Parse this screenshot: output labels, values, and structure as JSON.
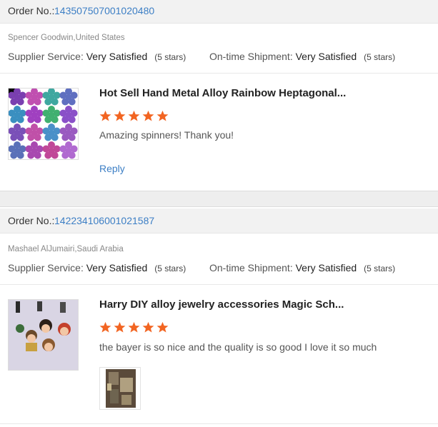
{
  "orders": [
    {
      "order_label": "Order No.:",
      "order_number": "143507507001020480",
      "buyer": "Spencer Goodwin,United States",
      "supplier_label": "Supplier Service:",
      "supplier_value": "Very Satisfied",
      "supplier_stars": "(5 stars)",
      "shipment_label": "On-time Shipment:",
      "shipment_value": "Very Satisfied",
      "shipment_stars": "(5 stars)",
      "product_title": "Hot Sell Hand Metal Alloy Rainbow Heptagonal...",
      "rating": 5,
      "comment": "Amazing spinners!  Thank you!",
      "reply_label": "Reply"
    },
    {
      "order_label": "Order No.:",
      "order_number": "142234106001021587",
      "buyer": "Mashael AlJumairi,Saudi Arabia",
      "supplier_label": "Supplier Service:",
      "supplier_value": "Very Satisfied",
      "supplier_stars": "(5 stars)",
      "shipment_label": "On-time Shipment:",
      "shipment_value": "Very Satisfied",
      "shipment_stars": "(5 stars)",
      "product_title": "Harry DIY alloy jewelry accessories Magic Sch...",
      "rating": 5,
      "comment": "the bayer is so nice and the quality is so good I love it so much"
    }
  ],
  "colors": {
    "star": "#f26522",
    "link": "#3d7fc5"
  },
  "icons": {
    "star": "star-icon"
  }
}
